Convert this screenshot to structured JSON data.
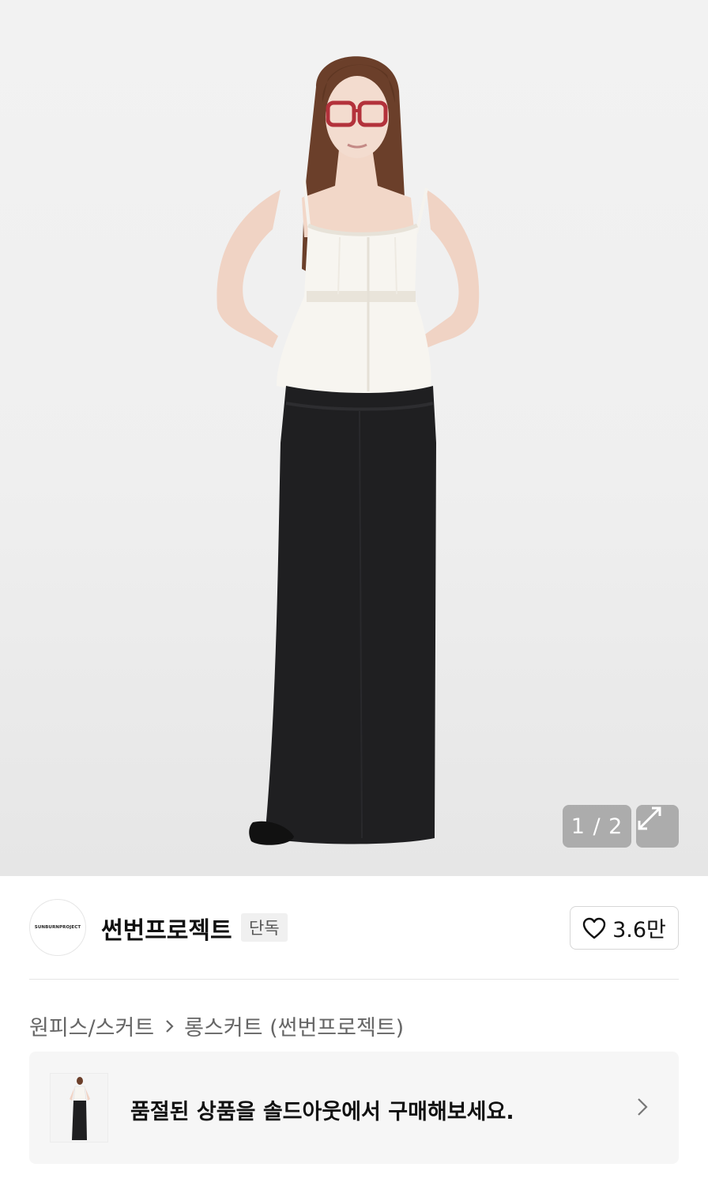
{
  "gallery": {
    "counter": "1 / 2",
    "expand_icon": "expand-icon"
  },
  "brand": {
    "logo_text": "SUNBURNPROJECT",
    "name": "썬번프로젝트",
    "badge": "단독",
    "like_count": "3.6만",
    "like_icon": "heart-icon"
  },
  "breadcrumb": {
    "category": "원피스/스커트",
    "subcategory": "롱스커트 (썬번프로젝트)"
  },
  "soldout_banner": {
    "message": "품절된 상품을 솔드아웃에서 구매해보세요."
  }
}
